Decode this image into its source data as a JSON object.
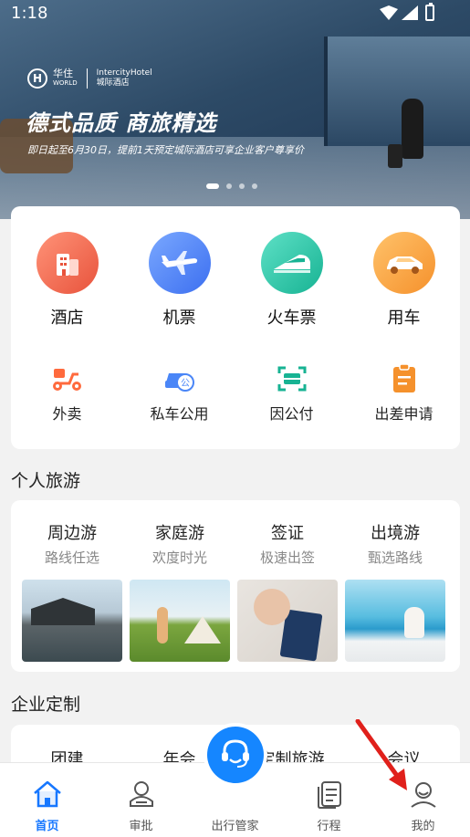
{
  "status_bar": {
    "time": "1:18"
  },
  "banner": {
    "brand_cn": "华住",
    "brand_world": "WORLD",
    "brand_hotel": "IntercityHotel",
    "brand_hotel_cn": "城际酒店",
    "title": "德式品质 商旅精选",
    "subtitle": "即日起至6月30日，提前1天预定城际酒店可享企业客户尊享价"
  },
  "services_main": [
    {
      "label": "酒店",
      "icon": "hotel-icon"
    },
    {
      "label": "机票",
      "icon": "plane-icon"
    },
    {
      "label": "火车票",
      "icon": "train-icon"
    },
    {
      "label": "用车",
      "icon": "car-icon"
    }
  ],
  "services_secondary": [
    {
      "label": "外卖",
      "icon": "scooter-icon"
    },
    {
      "label": "私车公用",
      "icon": "private-car-icon"
    },
    {
      "label": "因公付",
      "icon": "scan-pay-icon"
    },
    {
      "label": "出差申请",
      "icon": "clipboard-icon"
    }
  ],
  "personal_travel": {
    "title": "个人旅游",
    "items": [
      {
        "title": "周边游",
        "subtitle": "路线任选"
      },
      {
        "title": "家庭游",
        "subtitle": "欢度时光"
      },
      {
        "title": "签证",
        "subtitle": "极速出签"
      },
      {
        "title": "出境游",
        "subtitle": "甄选路线"
      }
    ]
  },
  "enterprise": {
    "title": "企业定制",
    "items": [
      "团建",
      "年会",
      "定制旅游",
      "会议"
    ]
  },
  "bottom_nav": [
    {
      "label": "首页",
      "icon": "home-icon",
      "active": true
    },
    {
      "label": "审批",
      "icon": "person-badge-icon"
    },
    {
      "label": "出行管家",
      "icon": "headset-icon"
    },
    {
      "label": "行程",
      "icon": "document-icon"
    },
    {
      "label": "我的",
      "icon": "user-icon"
    }
  ],
  "colors": {
    "accent": "#1677ff",
    "arrow": "#e0201b"
  }
}
